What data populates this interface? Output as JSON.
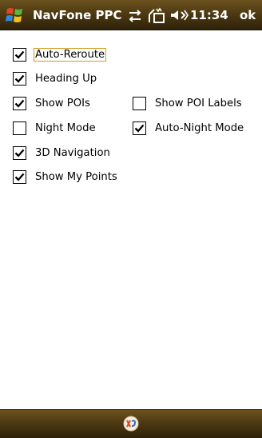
{
  "titlebar": {
    "app_title": "NavFone PPC",
    "clock": "11:34",
    "ok_label": "ok"
  },
  "options": [
    {
      "label": "Auto-Reroute",
      "checked": true,
      "focused": true
    },
    {
      "label": "Heading Up",
      "checked": true
    },
    {
      "label": "Show POIs",
      "checked": true
    },
    {
      "label": "Show POI Labels",
      "checked": false
    },
    {
      "label": "Night Mode",
      "checked": false
    },
    {
      "label": "Auto-Night Mode",
      "checked": true
    },
    {
      "label": "3D Navigation",
      "checked": true
    },
    {
      "label": "Show My Points",
      "checked": true
    }
  ],
  "colors": {
    "bar": "#4e3a12",
    "focus": "#d39b1e"
  },
  "icons": [
    "windows-start-icon",
    "connectivity-icon",
    "signal-off-icon",
    "volume-icon",
    "keyboard-sip-icon"
  ]
}
